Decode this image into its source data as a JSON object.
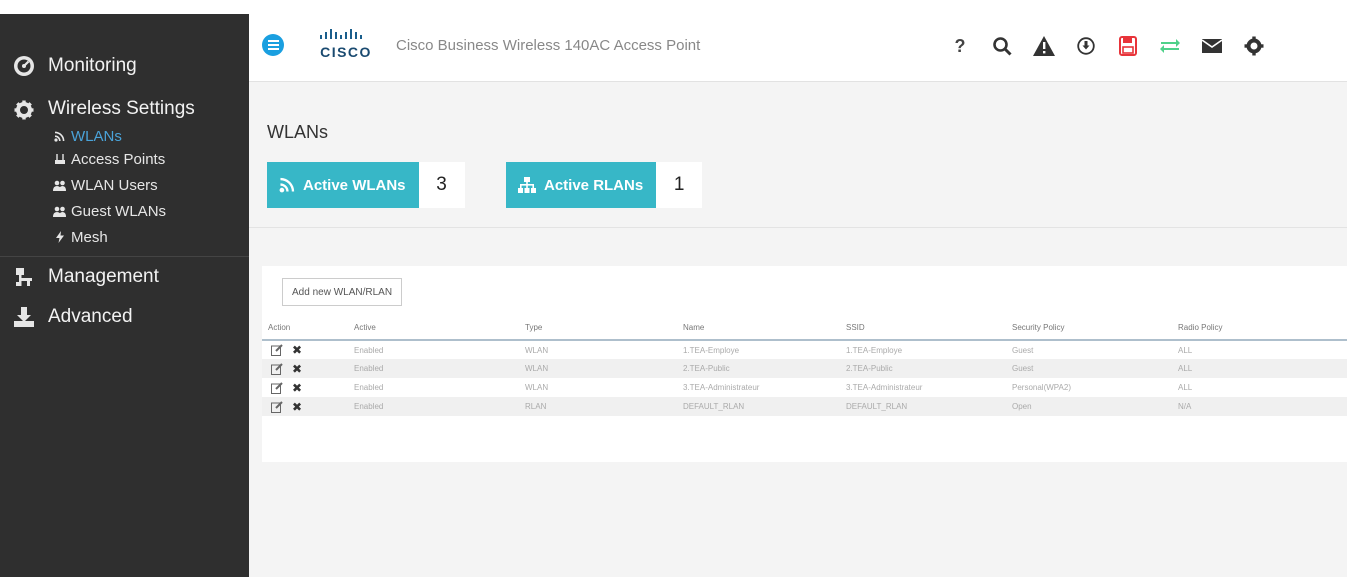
{
  "sidebar": {
    "monitoring": "Monitoring",
    "wireless_settings": "Wireless Settings",
    "wireless_items": [
      {
        "label": "WLANs",
        "icon": "wifi-icon",
        "active": true
      },
      {
        "label": "Access Points",
        "icon": "access-point-icon"
      },
      {
        "label": "WLAN Users",
        "icon": "users-icon"
      },
      {
        "label": "Guest WLANs",
        "icon": "guest-users-icon"
      },
      {
        "label": "Mesh",
        "icon": "bolt-icon"
      }
    ],
    "management": "Management",
    "advanced": "Advanced"
  },
  "header": {
    "logo_word": "CISCO",
    "title": "Cisco Business Wireless 140AC Access Point",
    "icons": [
      "help-icon",
      "search-icon",
      "alert-icon",
      "download-icon",
      "save-icon",
      "transfer-icon",
      "mail-icon",
      "settings-icon"
    ],
    "help_glyph": "?"
  },
  "main": {
    "page_title": "WLANs",
    "active_wlans_label": "Active WLANs",
    "active_wlans_count": "3",
    "active_rlans_label": "Active RLANs",
    "active_rlans_count": "1",
    "add_button": "Add new WLAN/RLAN",
    "columns": [
      "Action",
      "Active",
      "Type",
      "Name",
      "SSID",
      "Security Policy",
      "Radio Policy"
    ],
    "rows": [
      {
        "active": "Enabled",
        "type": "WLAN",
        "name": "1.TEA-Employe",
        "ssid": "1.TEA-Employe",
        "security": "Guest",
        "radio": "ALL"
      },
      {
        "active": "Enabled",
        "type": "WLAN",
        "name": "2.TEA-Public",
        "ssid": "2.TEA-Public",
        "security": "Guest",
        "radio": "ALL"
      },
      {
        "active": "Enabled",
        "type": "WLAN",
        "name": "3.TEA-Administrateur",
        "ssid": "3.TEA-Administrateur",
        "security": "Personal(WPA2)",
        "radio": "ALL"
      },
      {
        "active": "Enabled",
        "type": "RLAN",
        "name": "DEFAULT_RLAN",
        "ssid": "DEFAULT_RLAN",
        "security": "Open",
        "radio": "N/A"
      }
    ]
  },
  "colors": {
    "sidebar_bg": "#2f2f2f",
    "accent_teal": "#37b7c7",
    "active_link": "#4aa3d9",
    "menu_blue": "#1a9fe0",
    "save_red": "#e8343a",
    "transfer_green": "#4fd18a"
  }
}
